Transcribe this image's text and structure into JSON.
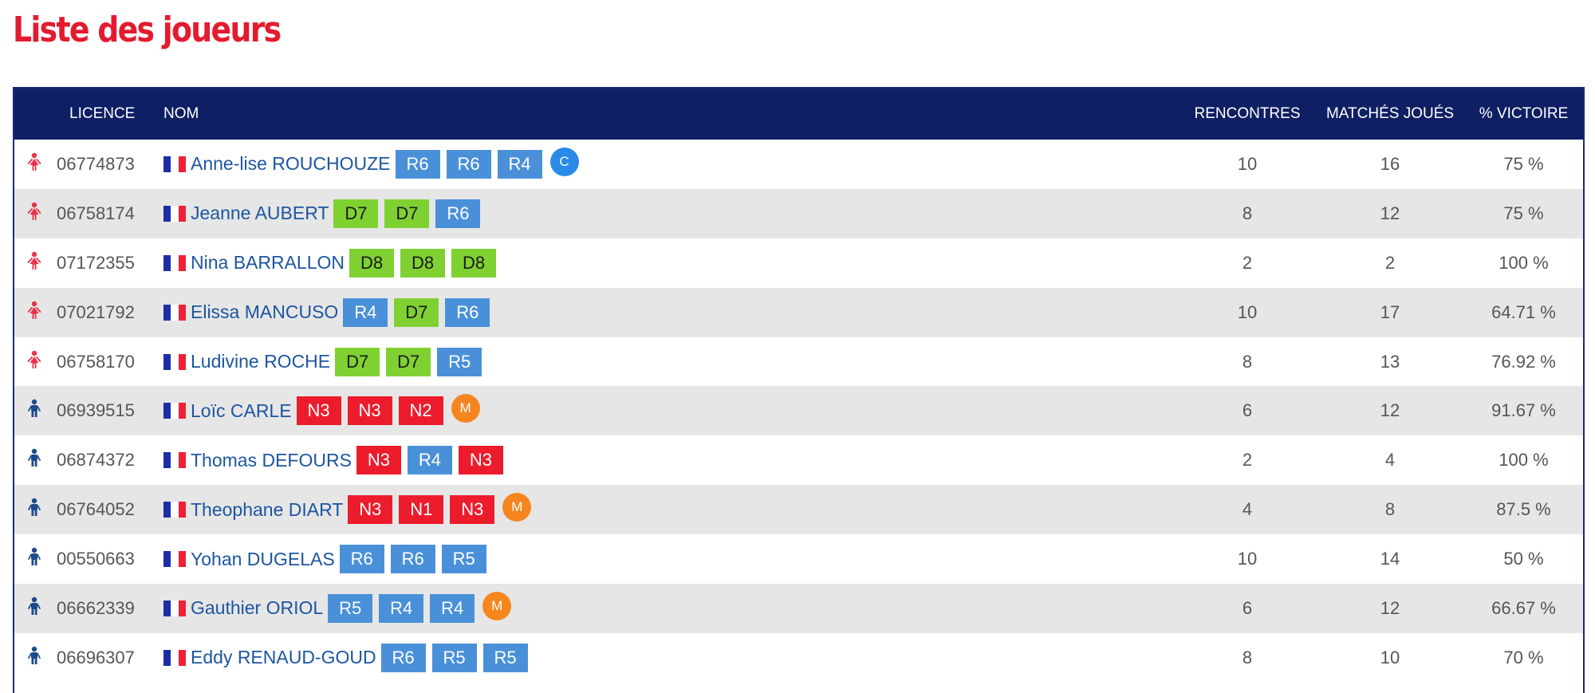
{
  "page": {
    "title": "Liste des joueurs"
  },
  "table": {
    "headers": {
      "licence": "LICENCE",
      "nom": "NOM",
      "rencontres": "RENCONTRES",
      "matches": "MATCHÉS JOUÉS",
      "victoire": "% VICTOIRE"
    },
    "rows": [
      {
        "gender": "female",
        "licence": "06774873",
        "name": "Anne-lise ROUCHOUZE",
        "ranks": [
          "R6",
          "R6",
          "R4"
        ],
        "badge": "C",
        "rencontres": "10",
        "matches": "16",
        "victoire": "75 %"
      },
      {
        "gender": "female",
        "licence": "06758174",
        "name": "Jeanne AUBERT",
        "ranks": [
          "D7",
          "D7",
          "R6"
        ],
        "badge": "",
        "rencontres": "8",
        "matches": "12",
        "victoire": "75 %"
      },
      {
        "gender": "female",
        "licence": "07172355",
        "name": "Nina BARRALLON",
        "ranks": [
          "D8",
          "D8",
          "D8"
        ],
        "badge": "",
        "rencontres": "2",
        "matches": "2",
        "victoire": "100 %"
      },
      {
        "gender": "female",
        "licence": "07021792",
        "name": "Elissa MANCUSO",
        "ranks": [
          "R4",
          "D7",
          "R6"
        ],
        "badge": "",
        "rencontres": "10",
        "matches": "17",
        "victoire": "64.71 %"
      },
      {
        "gender": "female",
        "licence": "06758170",
        "name": "Ludivine ROCHE",
        "ranks": [
          "D7",
          "D7",
          "R5"
        ],
        "badge": "",
        "rencontres": "8",
        "matches": "13",
        "victoire": "76.92 %"
      },
      {
        "gender": "male",
        "licence": "06939515",
        "name": "Loïc CARLE",
        "ranks": [
          "N3",
          "N3",
          "N2"
        ],
        "badge": "M",
        "rencontres": "6",
        "matches": "12",
        "victoire": "91.67 %"
      },
      {
        "gender": "male",
        "licence": "06874372",
        "name": "Thomas DEFOURS",
        "ranks": [
          "N3",
          "R4",
          "N3"
        ],
        "badge": "",
        "rencontres": "2",
        "matches": "4",
        "victoire": "100 %"
      },
      {
        "gender": "male",
        "licence": "06764052",
        "name": "Theophane DIART",
        "ranks": [
          "N3",
          "N1",
          "N3"
        ],
        "badge": "M",
        "rencontres": "4",
        "matches": "8",
        "victoire": "87.5 %"
      },
      {
        "gender": "male",
        "licence": "00550663",
        "name": "Yohan DUGELAS",
        "ranks": [
          "R6",
          "R6",
          "R5"
        ],
        "badge": "",
        "rencontres": "10",
        "matches": "14",
        "victoire": "50 %"
      },
      {
        "gender": "male",
        "licence": "06662339",
        "name": "Gauthier ORIOL",
        "ranks": [
          "R5",
          "R4",
          "R4"
        ],
        "badge": "M",
        "rencontres": "6",
        "matches": "12",
        "victoire": "66.67 %"
      },
      {
        "gender": "male",
        "licence": "06696307",
        "name": "Eddy RENAUD-GOUD",
        "ranks": [
          "R6",
          "R5",
          "R5"
        ],
        "badge": "",
        "rencontres": "8",
        "matches": "10",
        "victoire": "70 %"
      }
    ]
  },
  "icons": {
    "female": "female-player-icon",
    "male": "male-player-icon",
    "flag": "france-flag-icon"
  },
  "colors": {
    "title": "#e41b2f",
    "header_bg": "#0f1f63",
    "row_alt_bg": "#e6e6e6",
    "player_link": "#1c56a0",
    "rank_R": "#4a90d9",
    "rank_D": "#7fd132",
    "rank_N": "#ec1c2d",
    "badge_C": "#2a8ae8",
    "badge_M": "#f5861f",
    "female_icon": "#e8334a",
    "male_icon": "#1e4a8c"
  }
}
